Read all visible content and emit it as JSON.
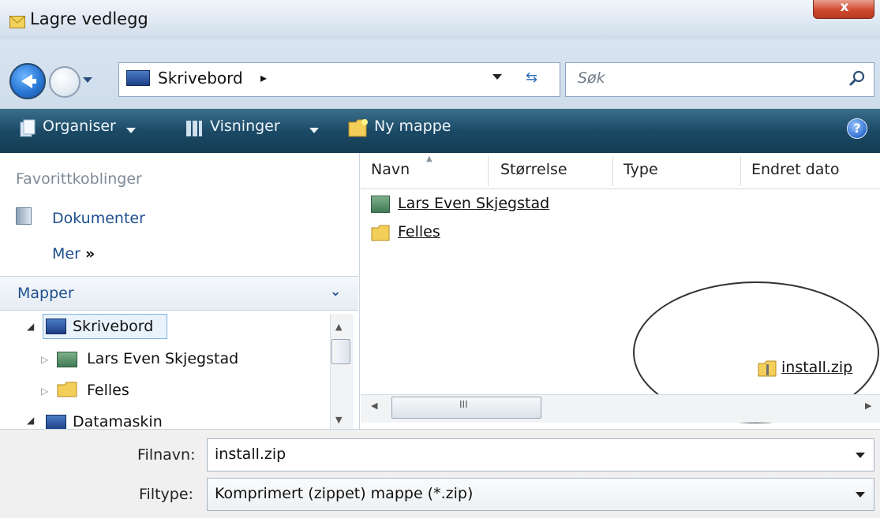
{
  "window": {
    "title": "Lagre vedlegg",
    "close_glyph": "x"
  },
  "address": {
    "location": "Skrivebord",
    "chevron": "▸",
    "search_placeholder": "Søk"
  },
  "toolbar": {
    "organise": "Organiser",
    "views": "Visninger",
    "new_folder": "Ny mappe",
    "help": "?"
  },
  "nav": {
    "favorites_heading": "Favorittkoblinger",
    "favorites": [
      "Dokumenter"
    ],
    "more_label": "Mer",
    "more_glyph": "»",
    "folders_heading": "Mapper",
    "folders_chevron": "⌄",
    "tree": [
      "Skrivebord",
      "Lars Even Skjegstad",
      "Felles",
      "Datamaskin"
    ]
  },
  "filelist": {
    "columns": [
      "Navn",
      "Størrelse",
      "Type",
      "Endret dato"
    ],
    "items": [
      "Lars Even Skjegstad",
      "Felles",
      "install.zip"
    ],
    "scroll_grip": "III"
  },
  "form": {
    "filename_label": "Filnavn:",
    "filename_value": "install.zip",
    "filetype_label": "Filtype:",
    "filetype_value": "Komprimert (zippet) mappe (*.zip)"
  },
  "colors": {
    "toolbar": "#1b4a66",
    "link": "#1f4f8f",
    "close": "#cf4a30"
  },
  "icons": [
    "folder-icon",
    "zip-icon",
    "user-icon",
    "desktop-icon",
    "search-icon",
    "help-icon"
  ]
}
